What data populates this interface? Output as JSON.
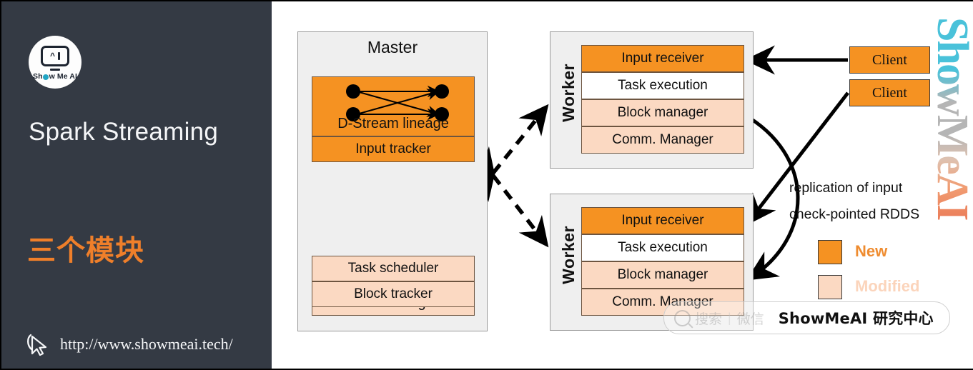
{
  "sidebar": {
    "logo": {
      "icon": "showmeai-logo-icon",
      "caret": "^",
      "bar": "I",
      "text_left": "Sh",
      "text_right": "w Me AI"
    },
    "title": "Spark Streaming",
    "subtitle": "三个模块",
    "cursor_icon": "cursor-arrow-icon",
    "url": "http://www.showmeai.tech/"
  },
  "diagram": {
    "master": {
      "title": "Master",
      "watermark": "ShowMeAI",
      "dstream_group": {
        "lineage_caption": "D-Stream lineage",
        "rows": [
          "Input tracker"
        ]
      },
      "rdd_group": {
        "lineage_caption": "RDD lineage",
        "rows": [
          "Task scheduler",
          "Block tracker"
        ]
      }
    },
    "workers": [
      {
        "label": "Worker",
        "rows": [
          "Input receiver",
          "Task execution",
          "Block manager",
          "Comm. Manager"
        ]
      },
      {
        "label": "Worker",
        "rows": [
          "Input receiver",
          "Task execution",
          "Block manager",
          "Comm. Manager"
        ]
      }
    ],
    "clients": [
      "Client",
      "Client"
    ],
    "annotations": [
      "replication of input",
      "check-pointed RDDS"
    ],
    "legend": [
      {
        "label": "New",
        "color": "#f59222"
      },
      {
        "label": "Modified",
        "color": "#fbd9c2"
      }
    ],
    "vertical_watermark": "ShowMeAI"
  },
  "wechat_badge": {
    "search_icon": "magnifier-icon",
    "search_text": "搜索",
    "separator": "|",
    "channel": "微信",
    "brand": "ShowMeAI 研究中心"
  },
  "colors": {
    "sidebar_bg": "#343a44",
    "accent_orange": "#ef7f2a",
    "new": "#f59222",
    "modified": "#fbd9c2",
    "panel_bg": "#efefef"
  }
}
